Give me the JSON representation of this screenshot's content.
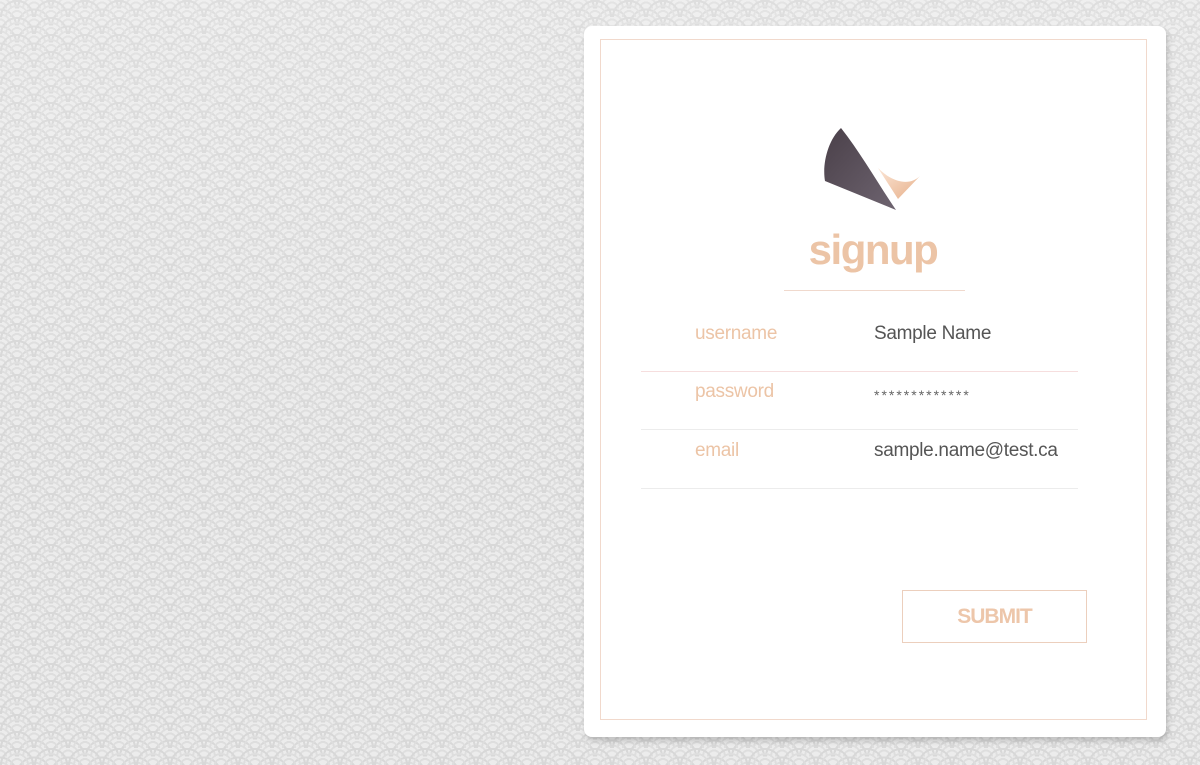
{
  "app": {
    "title": "signup"
  },
  "form": {
    "fields": [
      {
        "label": "username",
        "value": "Sample Name"
      },
      {
        "label": "password",
        "value": "*************"
      },
      {
        "label": "email",
        "value": "sample.name@test.ca"
      }
    ],
    "submit_label": "SUBMIT"
  },
  "icons": {
    "logo": "boat-sail-logo"
  },
  "colors": {
    "accent": "#ecc4a6",
    "logo_dark": "#4e4452",
    "logo_light": "#e8b58f",
    "text_value": "#555555"
  }
}
